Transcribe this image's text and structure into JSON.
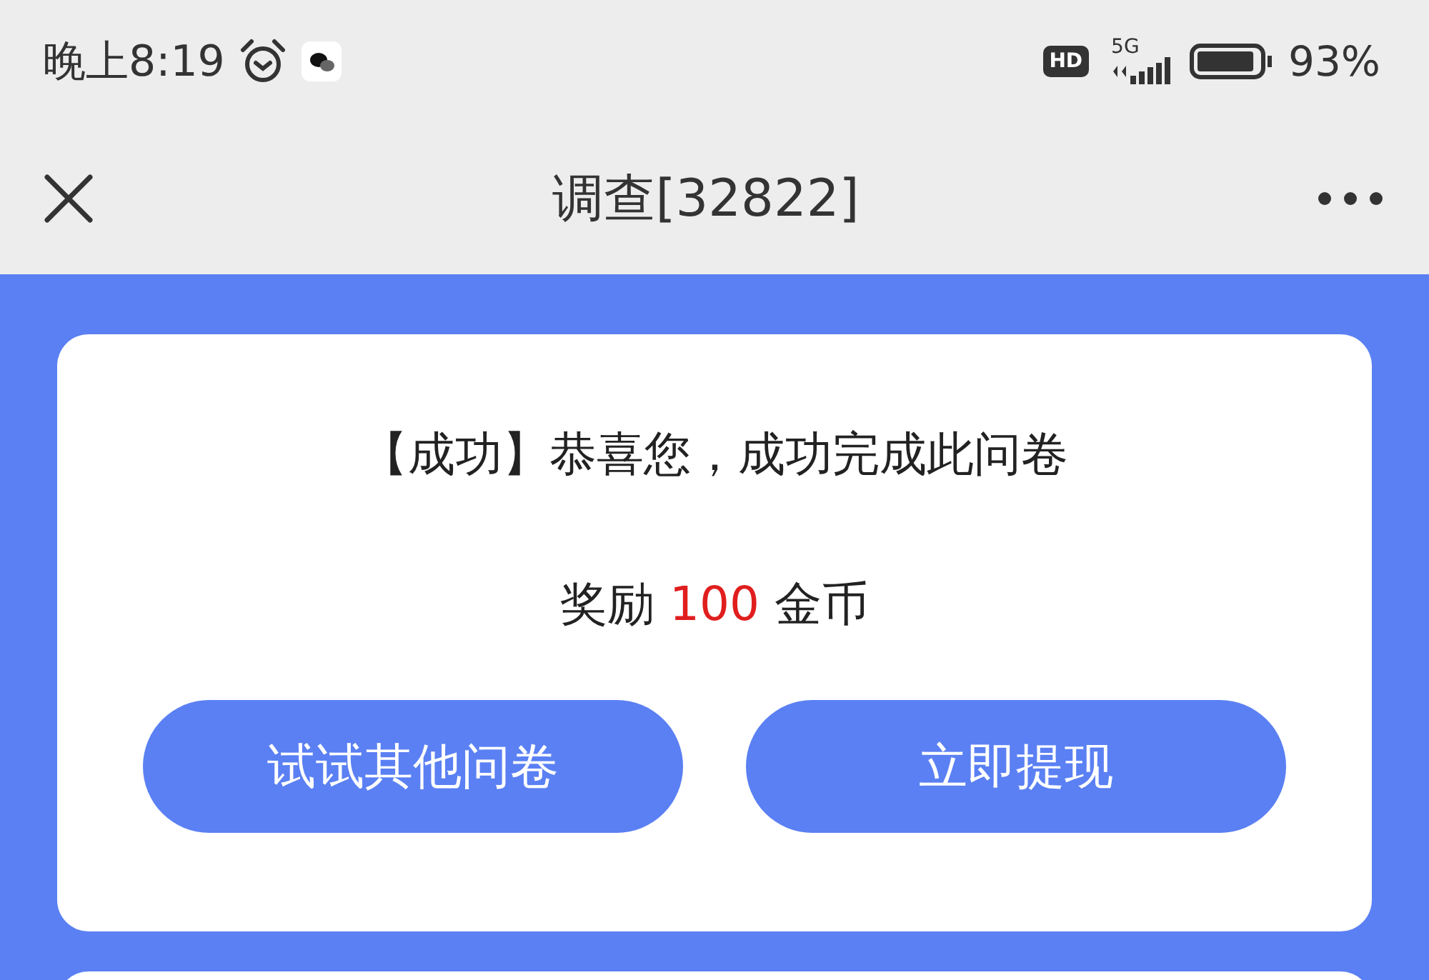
{
  "status_bar": {
    "time": "晚上8:19",
    "hd_badge": "HD",
    "network": "5G",
    "battery": "93%"
  },
  "title_bar": {
    "title": "调查[32822]"
  },
  "result_card": {
    "message": "【成功】恭喜您，成功完成此问卷",
    "reward": {
      "prefix": "奖励",
      "amount": "100",
      "suffix": "金币"
    },
    "buttons": [
      {
        "label": "试试其他问卷"
      },
      {
        "label": "立即提现"
      }
    ]
  }
}
